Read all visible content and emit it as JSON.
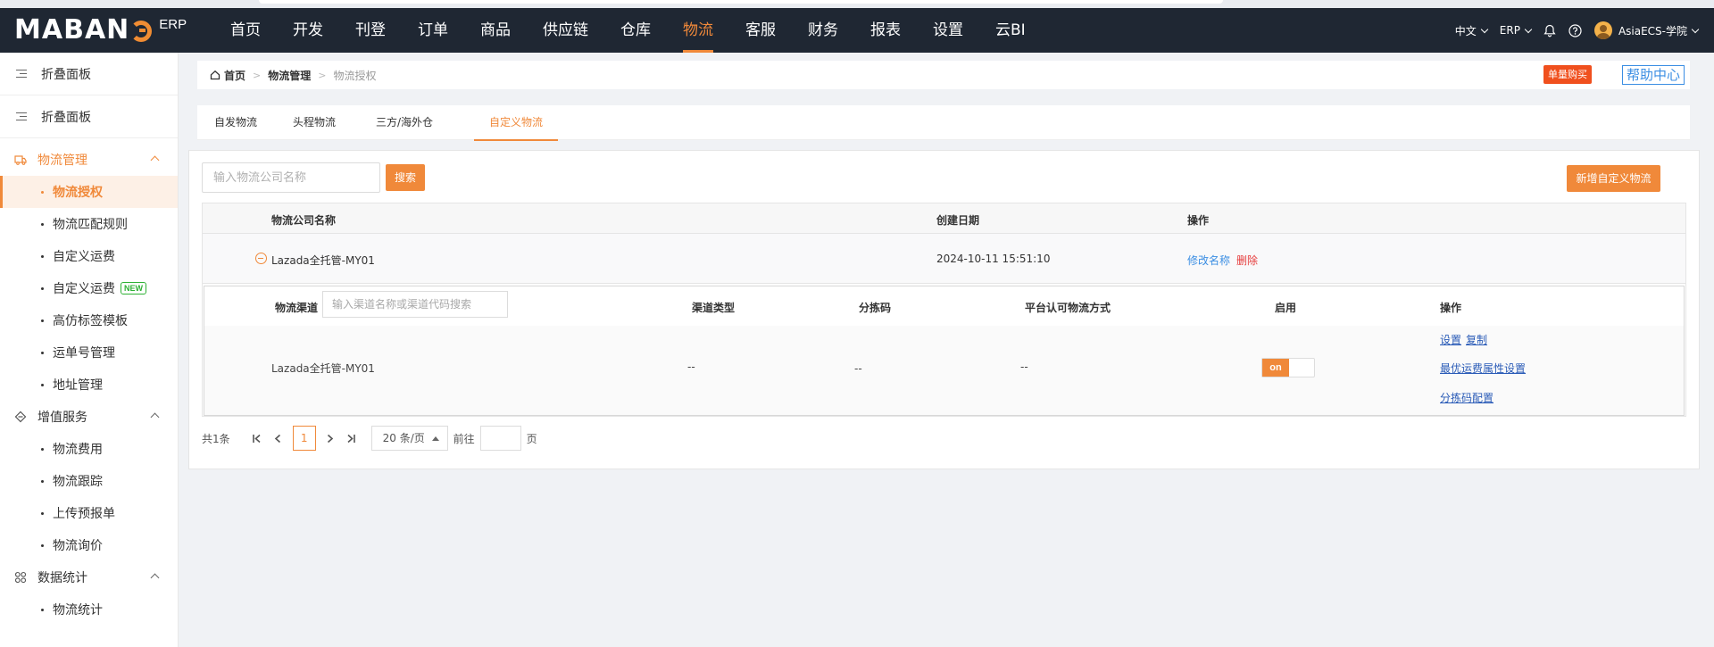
{
  "header": {
    "logo_text": "MABANG",
    "logo_suffix": "ERP",
    "nav": [
      {
        "label": "首页"
      },
      {
        "label": "开发"
      },
      {
        "label": "刊登"
      },
      {
        "label": "订单"
      },
      {
        "label": "商品"
      },
      {
        "label": "供应链"
      },
      {
        "label": "仓库"
      },
      {
        "label": "物流"
      },
      {
        "label": "客服"
      },
      {
        "label": "财务"
      },
      {
        "label": "报表"
      },
      {
        "label": "设置"
      },
      {
        "label": "云BI"
      }
    ],
    "active_nav": "物流",
    "lang": "中文",
    "system": "ERP",
    "user": "AsiaECS-学院"
  },
  "sidebar": {
    "fold_label_1": "折叠面板",
    "fold_label_2": "折叠面板",
    "groups": [
      {
        "label": "物流管理",
        "items": [
          {
            "label": "物流授权"
          },
          {
            "label": "物流匹配规则"
          },
          {
            "label": "自定义运费"
          },
          {
            "label": "自定义运费",
            "badge": "NEW"
          },
          {
            "label": "高仿标签模板"
          },
          {
            "label": "运单号管理"
          },
          {
            "label": "地址管理"
          }
        ]
      },
      {
        "label": "增值服务",
        "items": [
          {
            "label": "物流费用"
          },
          {
            "label": "物流跟踪"
          },
          {
            "label": "上传预报单"
          },
          {
            "label": "物流询价"
          }
        ]
      },
      {
        "label": "数据统计",
        "items": [
          {
            "label": "物流统计"
          }
        ]
      }
    ]
  },
  "breadcrumb": {
    "home": "首页",
    "level1": "物流管理",
    "level2": "物流授权",
    "buy_btn": "单量购买",
    "help_btn": "帮助中心"
  },
  "tabs": [
    {
      "label": "自发物流"
    },
    {
      "label": "头程物流"
    },
    {
      "label": "三方/海外仓"
    },
    {
      "label": "自定义物流"
    }
  ],
  "toolbar": {
    "search_placeholder": "输入物流公司名称",
    "search_btn": "搜索",
    "add_btn": "新增自定义物流"
  },
  "table": {
    "headers": {
      "company": "物流公司名称",
      "created": "创建日期",
      "ops": "操作"
    },
    "row": {
      "company": "Lazada全托管-MY01",
      "created": "2024-10-11 15:51:10",
      "rename": "修改名称",
      "delete": "删除"
    },
    "sub": {
      "headers": {
        "channel": "物流渠道",
        "channel_type": "渠道类型",
        "sort_code": "分拣码",
        "platform_method": "平台认可物流方式",
        "enabled": "启用",
        "ops": "操作"
      },
      "channel_placeholder": "输入渠道名称或渠道代码搜索",
      "row": {
        "channel": "Lazada全托管-MY01",
        "channel_type": "--",
        "sort_code": "--",
        "platform_method": "--",
        "toggle": "on",
        "op_settings": "设置",
        "op_copy": "复制",
        "op_optimal": "最优运费属性设置",
        "op_sort_code": "分拣码配置"
      }
    }
  },
  "pager": {
    "total": "共1条",
    "current": "1",
    "page_size": "20 条/页",
    "goto_label": "前往",
    "page_suffix": "页"
  }
}
